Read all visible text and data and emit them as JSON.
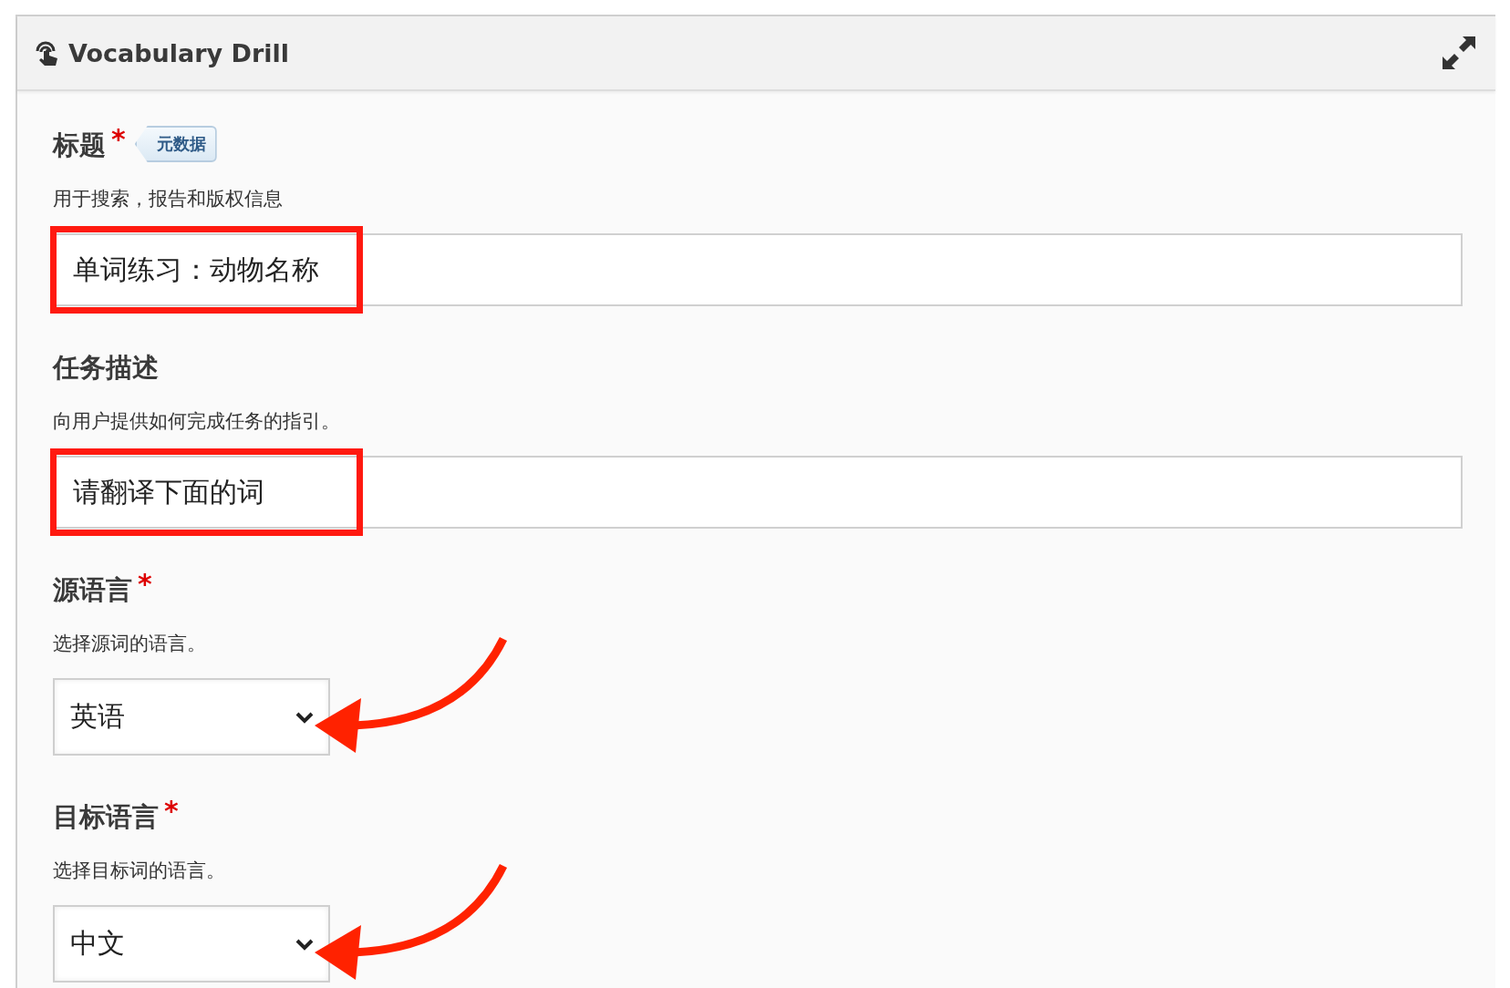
{
  "panel": {
    "title": "Vocabulary Drill"
  },
  "fields": [
    {
      "kind": "text",
      "label": "标题",
      "required_mark": "*",
      "badge": "元数据",
      "description": "用于搜索，报告和版权信息",
      "value": "单词练习：动物名称",
      "highlighted": true,
      "pointed": false
    },
    {
      "kind": "text",
      "label": "任务描述",
      "description": "向用户提供如何完成任务的指引。",
      "value": "请翻译下面的词",
      "highlighted": true,
      "pointed": false
    },
    {
      "kind": "select",
      "label": "源语言",
      "required_mark": "*",
      "description": "选择源词的语言。",
      "value": "英语",
      "highlighted": false,
      "pointed": true
    },
    {
      "kind": "select",
      "label": "目标语言",
      "required_mark": "*",
      "description": "选择目标词的语言。",
      "value": "中文",
      "highlighted": false,
      "pointed": true
    }
  ]
}
